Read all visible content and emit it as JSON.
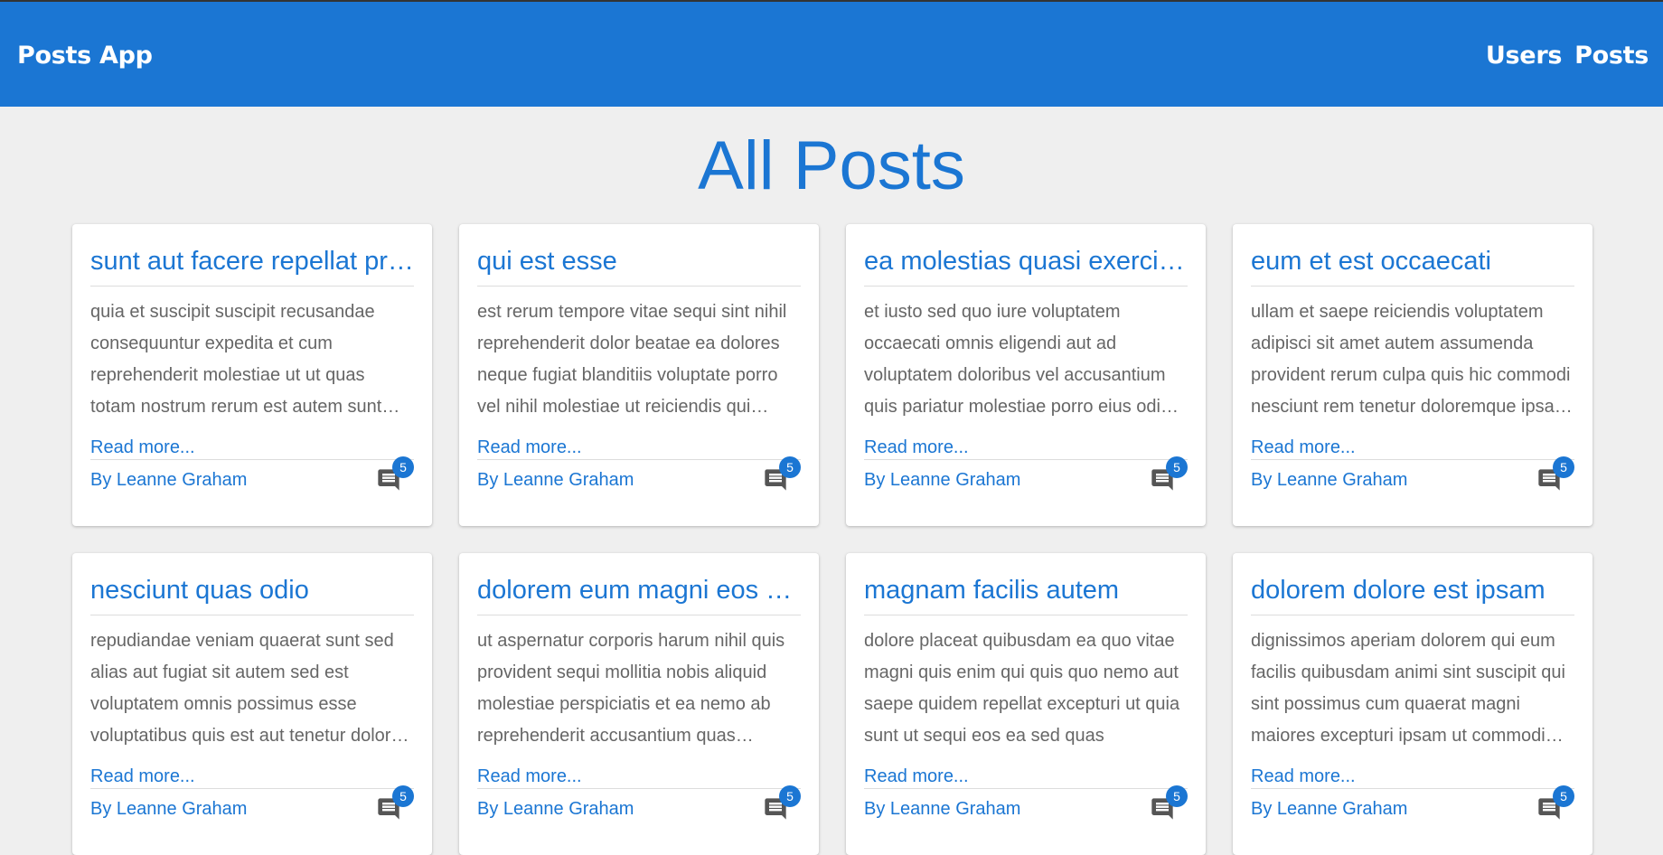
{
  "app": {
    "title": "Posts App",
    "nav": [
      "Users",
      "Posts"
    ]
  },
  "page": {
    "title": "All Posts"
  },
  "cards": [
    {
      "title": "sunt aut facere repellat provident occaecati excepturi optio reprehenderit",
      "body": "quia et suscipit suscipit recusandae consequuntur expedita et cum reprehenderit molestiae ut ut quas totam nostrum rerum est autem sunt rem eveniet architecto",
      "read_more": "Read more...",
      "author": "By Leanne Graham",
      "comments": "5"
    },
    {
      "title": "qui est esse",
      "body": "est rerum tempore vitae sequi sint nihil reprehenderit dolor beatae ea dolores neque fugiat blanditiis voluptate porro vel nihil molestiae ut reiciendis qui aperiam non debitis possimus qui neque nisi nulla",
      "read_more": "Read more...",
      "author": "By Leanne Graham",
      "comments": "5"
    },
    {
      "title": "ea molestias quasi exercitationem repellat qui ipsa sit aut",
      "body": "et iusto sed quo iure voluptatem occaecati omnis eligendi aut ad voluptatem doloribus vel accusantium quis pariatur molestiae porro eius odio et labore et velit aut",
      "read_more": "Read more...",
      "author": "By Leanne Graham",
      "comments": "5"
    },
    {
      "title": "eum et est occaecati",
      "body": "ullam et saepe reiciendis voluptatem adipisci sit amet autem assumenda provident rerum culpa quis hic commodi nesciunt rem tenetur doloremque ipsam iure quis sunt voluptatem rerum illo velit",
      "read_more": "Read more...",
      "author": "By Leanne Graham",
      "comments": "5"
    },
    {
      "title": "nesciunt quas odio",
      "body": "repudiandae veniam quaerat sunt sed alias aut fugiat sit autem sed est voluptatem omnis possimus esse voluptatibus quis est aut tenetur dolor neque",
      "read_more": "Read more...",
      "author": "By Leanne Graham",
      "comments": "5"
    },
    {
      "title": "dolorem eum magni eos aperiam quia",
      "body": "ut aspernatur corporis harum nihil quis provident sequi mollitia nobis aliquid molestiae perspiciatis et ea nemo ab reprehenderit accusantium quas voluptate dolores velit et doloremque molestiae",
      "read_more": "Read more...",
      "author": "By Leanne Graham",
      "comments": "5"
    },
    {
      "title": "magnam facilis autem",
      "body": "dolore placeat quibusdam ea quo vitae magni quis enim qui quis quo nemo aut saepe quidem repellat excepturi ut quia sunt ut sequi eos ea sed quas",
      "read_more": "Read more...",
      "author": "By Leanne Graham",
      "comments": "5"
    },
    {
      "title": "dolorem dolore est ipsam",
      "body": "dignissimos aperiam dolorem qui eum facilis quibusdam animi sint suscipit qui sint possimus cum quaerat magni maiores excepturi ipsam ut commodi dolor voluptatum modi aut vitae",
      "read_more": "Read more...",
      "author": "By Leanne Graham",
      "comments": "5"
    }
  ],
  "colors": {
    "primary": "#1b76d3",
    "background": "#efefef",
    "body_text": "#666666",
    "icon": "#555555"
  },
  "icons": {
    "comments": "comment-icon"
  }
}
